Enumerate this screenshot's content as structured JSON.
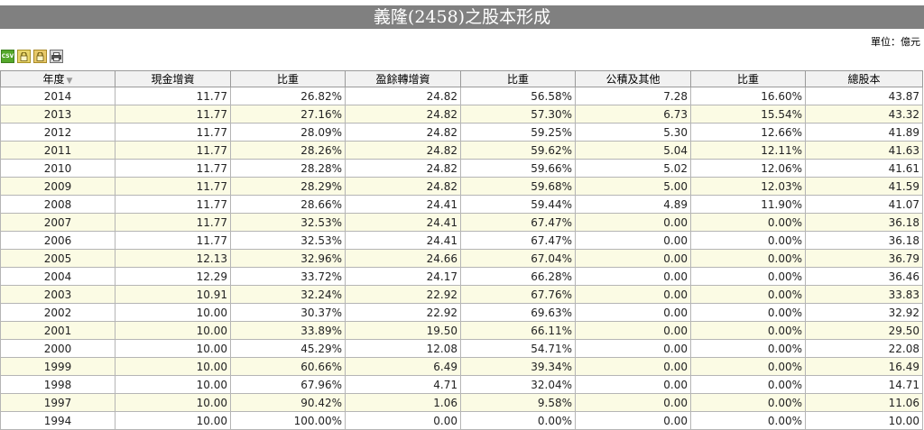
{
  "page": {
    "title": "義隆(2458)之股本形成",
    "unit_label": "單位：億元"
  },
  "toolbar": {
    "csv_label": "CSV",
    "icons": [
      "csv-export-icon",
      "lock-icon",
      "lock-icon",
      "print-icon"
    ]
  },
  "table": {
    "headers": [
      "年度",
      "現金增資",
      "比重",
      "盈餘轉增資",
      "比重",
      "公積及其他",
      "比重",
      "總股本"
    ],
    "sort_icon": "sort-arrow-icon",
    "rows": [
      [
        "2014",
        "11.77",
        "26.82%",
        "24.82",
        "56.58%",
        "7.28",
        "16.60%",
        "43.87"
      ],
      [
        "2013",
        "11.77",
        "27.16%",
        "24.82",
        "57.30%",
        "6.73",
        "15.54%",
        "43.32"
      ],
      [
        "2012",
        "11.77",
        "28.09%",
        "24.82",
        "59.25%",
        "5.30",
        "12.66%",
        "41.89"
      ],
      [
        "2011",
        "11.77",
        "28.26%",
        "24.82",
        "59.62%",
        "5.04",
        "12.11%",
        "41.63"
      ],
      [
        "2010",
        "11.77",
        "28.28%",
        "24.82",
        "59.66%",
        "5.02",
        "12.06%",
        "41.61"
      ],
      [
        "2009",
        "11.77",
        "28.29%",
        "24.82",
        "59.68%",
        "5.00",
        "12.03%",
        "41.59"
      ],
      [
        "2008",
        "11.77",
        "28.66%",
        "24.41",
        "59.44%",
        "4.89",
        "11.90%",
        "41.07"
      ],
      [
        "2007",
        "11.77",
        "32.53%",
        "24.41",
        "67.47%",
        "0.00",
        "0.00%",
        "36.18"
      ],
      [
        "2006",
        "11.77",
        "32.53%",
        "24.41",
        "67.47%",
        "0.00",
        "0.00%",
        "36.18"
      ],
      [
        "2005",
        "12.13",
        "32.96%",
        "24.66",
        "67.04%",
        "0.00",
        "0.00%",
        "36.79"
      ],
      [
        "2004",
        "12.29",
        "33.72%",
        "24.17",
        "66.28%",
        "0.00",
        "0.00%",
        "36.46"
      ],
      [
        "2003",
        "10.91",
        "32.24%",
        "22.92",
        "67.76%",
        "0.00",
        "0.00%",
        "33.83"
      ],
      [
        "2002",
        "10.00",
        "30.37%",
        "22.92",
        "69.63%",
        "0.00",
        "0.00%",
        "32.92"
      ],
      [
        "2001",
        "10.00",
        "33.89%",
        "19.50",
        "66.11%",
        "0.00",
        "0.00%",
        "29.50"
      ],
      [
        "2000",
        "10.00",
        "45.29%",
        "12.08",
        "54.71%",
        "0.00",
        "0.00%",
        "22.08"
      ],
      [
        "1999",
        "10.00",
        "60.66%",
        "6.49",
        "39.34%",
        "0.00",
        "0.00%",
        "16.49"
      ],
      [
        "1998",
        "10.00",
        "67.96%",
        "4.71",
        "32.04%",
        "0.00",
        "0.00%",
        "14.71"
      ],
      [
        "1997",
        "10.00",
        "90.42%",
        "1.06",
        "9.58%",
        "0.00",
        "0.00%",
        "11.06"
      ],
      [
        "1994",
        "10.00",
        "100.00%",
        "0.00",
        "0.00%",
        "0.00",
        "0.00%",
        "10.00"
      ]
    ]
  }
}
